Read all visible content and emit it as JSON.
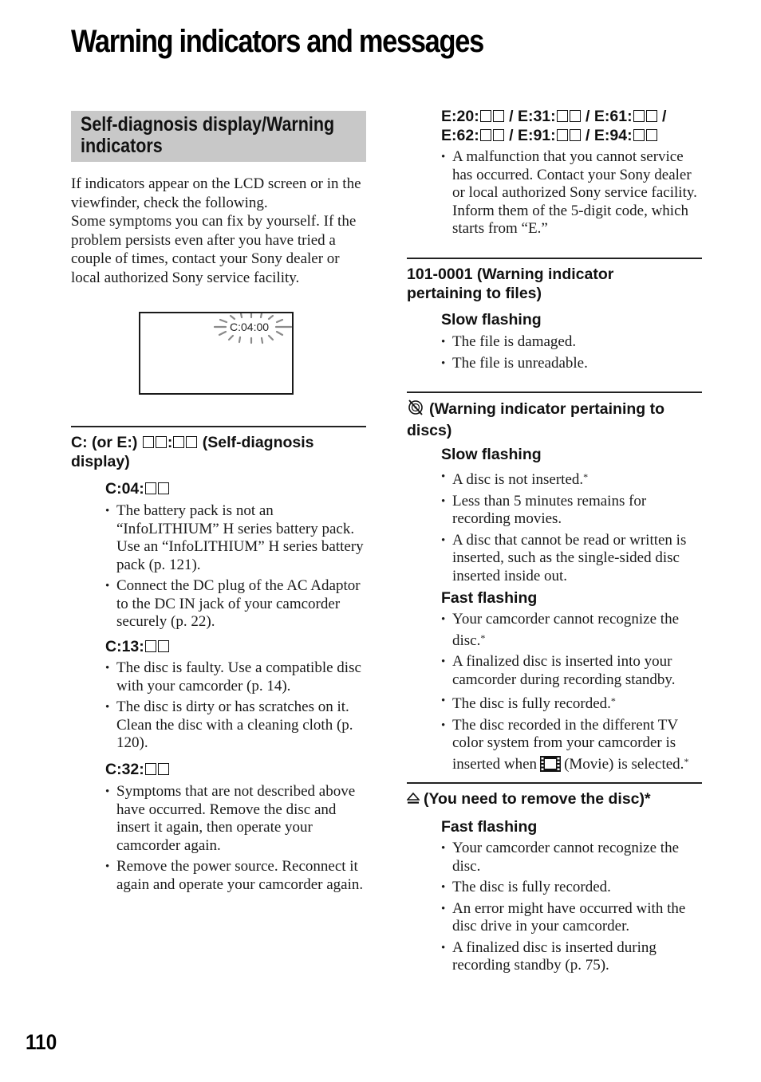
{
  "page": {
    "title": "Warning indicators and messages",
    "page_number": "110"
  },
  "section": {
    "title_line1": "Self-diagnosis display/Warning",
    "title_line2": "indicators",
    "intro_p1": "If indicators appear on the LCD screen or in the viewfinder, check the following.",
    "intro_p2": "Some symptoms you can fix by yourself. If the problem persists even after you have tried a couple of times, contact your Sony dealer or local authorized Sony service facility.",
    "lcd_code": "C:04:00"
  },
  "self_diagnosis": {
    "heading_prefix": "C: (or E:) ",
    "heading_sep": ":",
    "heading_suffix": " (Self-diagnosis",
    "heading_line2": "display)",
    "codes": [
      {
        "code": "C:04:",
        "items": [
          "The battery pack is not an “InfoLITHIUM” H series battery pack. Use an “InfoLITHIUM” H series battery pack (p. 121).",
          "Connect the DC plug of the AC Adaptor to the DC IN jack of your camcorder securely (p. 22)."
        ]
      },
      {
        "code": "C:13:",
        "items": [
          "The disc is faulty. Use a compatible disc with your camcorder (p. 14).",
          "The disc is dirty or has scratches on it. Clean the disc with a cleaning cloth (p. 120)."
        ]
      },
      {
        "code": "C:32:",
        "items": [
          "Symptoms that are not described above have occurred. Remove the disc and insert it again, then operate your camcorder again.",
          "Remove the power source. Reconnect it again and operate your camcorder again."
        ]
      }
    ]
  },
  "e_codes": {
    "line1": [
      "E:20:",
      " / E:31:",
      " / E:61:",
      " /"
    ],
    "line2": [
      "E:62:",
      " / E:91:",
      " / E:94:"
    ],
    "items": [
      "A malfunction that you cannot service has occurred. Contact your Sony dealer or local authorized Sony service facility. Inform them of the 5-digit code, which starts from “E.”"
    ]
  },
  "files_warning": {
    "heading_line1": "101-0001 (Warning indicator",
    "heading_line2": "pertaining to files)",
    "slow_label": "Slow flashing",
    "slow_items": [
      "The file is damaged.",
      "The file is unreadable."
    ]
  },
  "disc_warning": {
    "icon": "no-disc-icon",
    "heading_line1": "(Warning indicator pertaining to",
    "heading_line2": "discs)",
    "slow_label": "Slow flashing",
    "slow_items": [
      {
        "text": "A disc is not inserted.",
        "note": "*"
      },
      {
        "text": "Less than 5 minutes remains for recording movies.",
        "note": ""
      },
      {
        "text": "A disc that cannot be read or written is inserted, such as the single-sided disc inserted inside out.",
        "note": ""
      }
    ],
    "fast_label": "Fast flashing",
    "fast_items": [
      {
        "text": "Your camcorder cannot recognize the disc.",
        "note": "*"
      },
      {
        "text": "A finalized disc is inserted into your camcorder during recording standby.",
        "note": ""
      },
      {
        "text": "The disc is fully recorded.",
        "note": "*"
      }
    ],
    "tv_item_part1": "The disc recorded in the different TV color system from your camcorder is inserted when",
    "tv_item_icon": "movie-film-icon",
    "tv_item_part2": "(Movie) is selected.",
    "tv_item_note": "*"
  },
  "remove_disc": {
    "icon": "eject-icon",
    "heading": "(You need to remove the disc)*",
    "fast_label": "Fast flashing",
    "fast_items": [
      "Your camcorder cannot recognize the disc.",
      "The disc is fully recorded.",
      "An error might have occurred with the disc drive in your camcorder.",
      "A finalized disc is inserted during recording standby (p. 75)."
    ]
  }
}
